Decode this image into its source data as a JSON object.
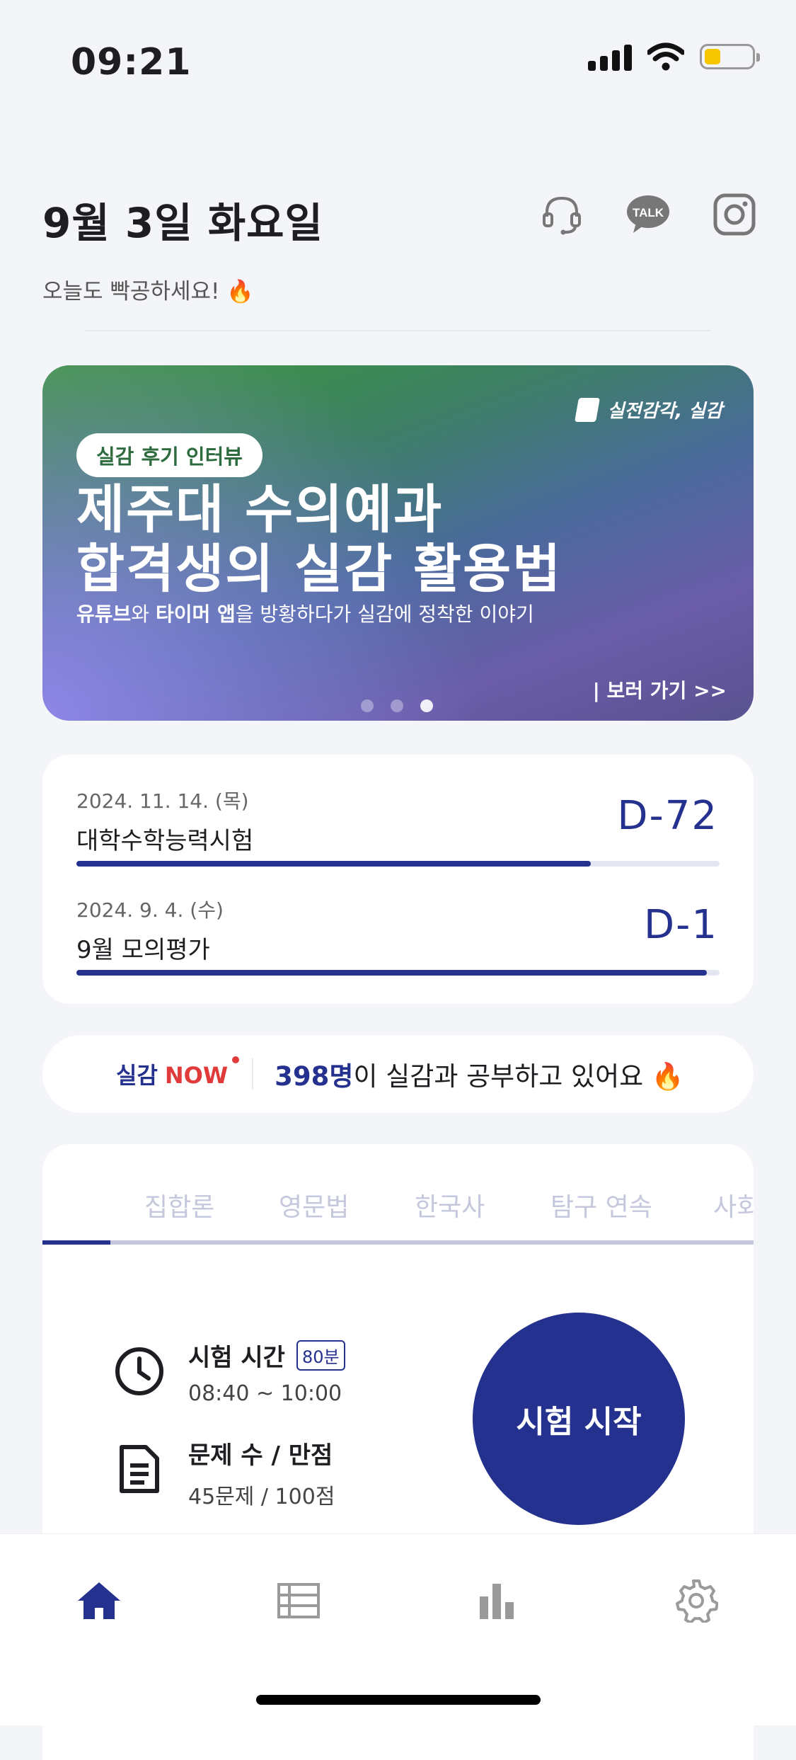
{
  "status_bar": {
    "time": "09:21"
  },
  "header": {
    "date_title": "9월 3일 화요일",
    "subtitle": "오늘도 빡공하세요! 🔥",
    "icons": [
      "headset-icon",
      "kakao-talk-icon",
      "instagram-icon"
    ],
    "talk_label": "TALK"
  },
  "banner": {
    "brand": "실전감각, 실감",
    "tag": "실감 후기 인터뷰",
    "title_line1": "제주대 수의예과",
    "title_line2": "합격생의 실감 활용법",
    "desc_b1": "유튜브",
    "desc_t1": "와 ",
    "desc_b2": "타이머 앱",
    "desc_t2": "을 방황하다가 실감에 정착한 이야기",
    "link": "| 보러 가기 >>",
    "page_count": 3,
    "active_page": 3
  },
  "ddays": [
    {
      "date": "2024. 11. 14. (목)",
      "name": "대학수학능력시험",
      "count": "D-72",
      "progress": 0.8
    },
    {
      "date": "2024. 9. 4. (수)",
      "name": "9월 모의평가",
      "count": "D-1",
      "progress": 0.98
    }
  ],
  "now_bar": {
    "label": "실감",
    "now": "NOW",
    "count": "398명",
    "text": "이 실감과 공부하고 있어요 🔥"
  },
  "exam": {
    "tabs": [
      "집합론",
      "영문법",
      "한국사",
      "탐구 연속",
      "사회"
    ],
    "active_tab_progress": 0.1,
    "time_title": "시험 시간",
    "time_badge": "80분",
    "time_value": "08:40 ~ 10:00",
    "questions_title": "문제 수 / 만점",
    "questions_value": "45문제 / 100점",
    "start_label": "시험 시작"
  },
  "bottom_nav": {
    "items": [
      "home-icon",
      "list-icon",
      "stats-icon",
      "settings-icon"
    ],
    "active": "home-icon"
  },
  "colors": {
    "primary": "#25318E",
    "accent_red": "#E03A3A",
    "background": "#F4F5F8"
  }
}
